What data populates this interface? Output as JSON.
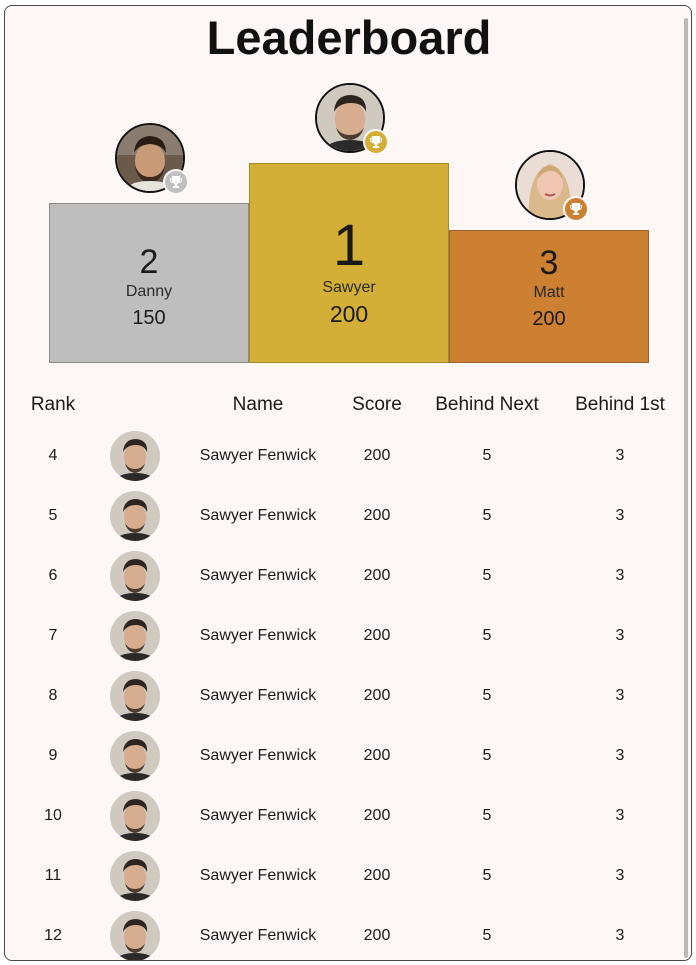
{
  "title": "Leaderboard",
  "podium": [
    {
      "place": "2",
      "name": "Danny",
      "score": "150",
      "medal": "silver",
      "avatar": "man-bearded-avatar"
    },
    {
      "place": "1",
      "name": "Sawyer",
      "score": "200",
      "medal": "gold",
      "avatar": "man-avatar"
    },
    {
      "place": "3",
      "name": "Matt",
      "score": "200",
      "medal": "bronze",
      "avatar": "woman-blonde-avatar"
    }
  ],
  "table": {
    "headers": [
      "Rank",
      "Name",
      "Score",
      "Behind Next",
      "Behind 1st"
    ],
    "rows": [
      {
        "rank": "4",
        "name": "Sawyer Fenwick",
        "score": "200",
        "behind_next": "5",
        "behind_first": "3"
      },
      {
        "rank": "5",
        "name": "Sawyer Fenwick",
        "score": "200",
        "behind_next": "5",
        "behind_first": "3"
      },
      {
        "rank": "6",
        "name": "Sawyer Fenwick",
        "score": "200",
        "behind_next": "5",
        "behind_first": "3"
      },
      {
        "rank": "7",
        "name": "Sawyer Fenwick",
        "score": "200",
        "behind_next": "5",
        "behind_first": "3"
      },
      {
        "rank": "8",
        "name": "Sawyer Fenwick",
        "score": "200",
        "behind_next": "5",
        "behind_first": "3"
      },
      {
        "rank": "9",
        "name": "Sawyer Fenwick",
        "score": "200",
        "behind_next": "5",
        "behind_first": "3"
      },
      {
        "rank": "10",
        "name": "Sawyer Fenwick",
        "score": "200",
        "behind_next": "5",
        "behind_first": "3"
      },
      {
        "rank": "11",
        "name": "Sawyer Fenwick",
        "score": "200",
        "behind_next": "5",
        "behind_first": "3"
      },
      {
        "rank": "12",
        "name": "Sawyer Fenwick",
        "score": "200",
        "behind_next": "5",
        "behind_first": "3"
      }
    ]
  },
  "colors": {
    "gold": "#d4af37",
    "silver": "#bebebe",
    "bronze": "#cd7f32",
    "background": "#fdf8f6"
  },
  "icons": {
    "trophy": "trophy-icon",
    "avatar": "avatar"
  }
}
